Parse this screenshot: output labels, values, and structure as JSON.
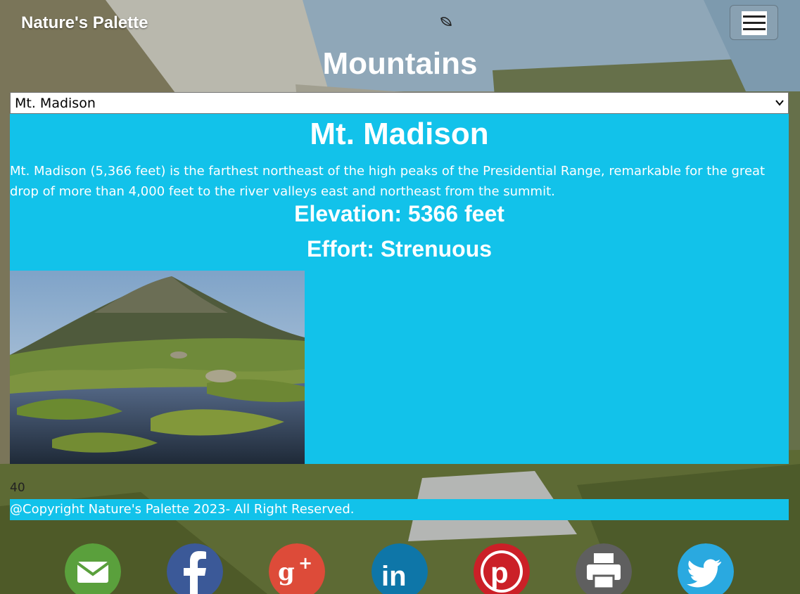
{
  "header": {
    "brand": "Nature's Palette",
    "leaf_icon": "leaf-icon",
    "menu_icon": "hamburger-menu-icon"
  },
  "page": {
    "title": "Mountains"
  },
  "selector": {
    "selected": "Mt. Madison",
    "chevron_icon": "chevron-down-icon"
  },
  "mountain": {
    "name": "Mt. Madison",
    "description": "Mt. Madison (5,366 feet) is the farthest northeast of the high peaks of the Presidential Range, remarkable for the great drop of more than 4,000 feet to the river valleys east and northeast from the summit.",
    "elevation": "Elevation: 5366 feet",
    "effort": "Effort: Strenuous",
    "photo_icon": "mountain-photo"
  },
  "counter": "40",
  "footer": {
    "copyright": "@Copyright Nature's Palette 2023- All Right Reserved."
  },
  "social": [
    {
      "name": "email-icon",
      "color": "#5aa03c"
    },
    {
      "name": "facebook-icon",
      "color": "#3b5998"
    },
    {
      "name": "google-plus-icon",
      "color": "#dd4b39"
    },
    {
      "name": "linkedin-icon",
      "color": "#0e76a8"
    },
    {
      "name": "pinterest-icon",
      "color": "#cb2027"
    },
    {
      "name": "print-icon",
      "color": "#5f5f5f"
    },
    {
      "name": "twitter-icon",
      "color": "#2aa9e0"
    }
  ],
  "colors": {
    "card_bg": "#12c2ea",
    "text": "#ffffff"
  }
}
